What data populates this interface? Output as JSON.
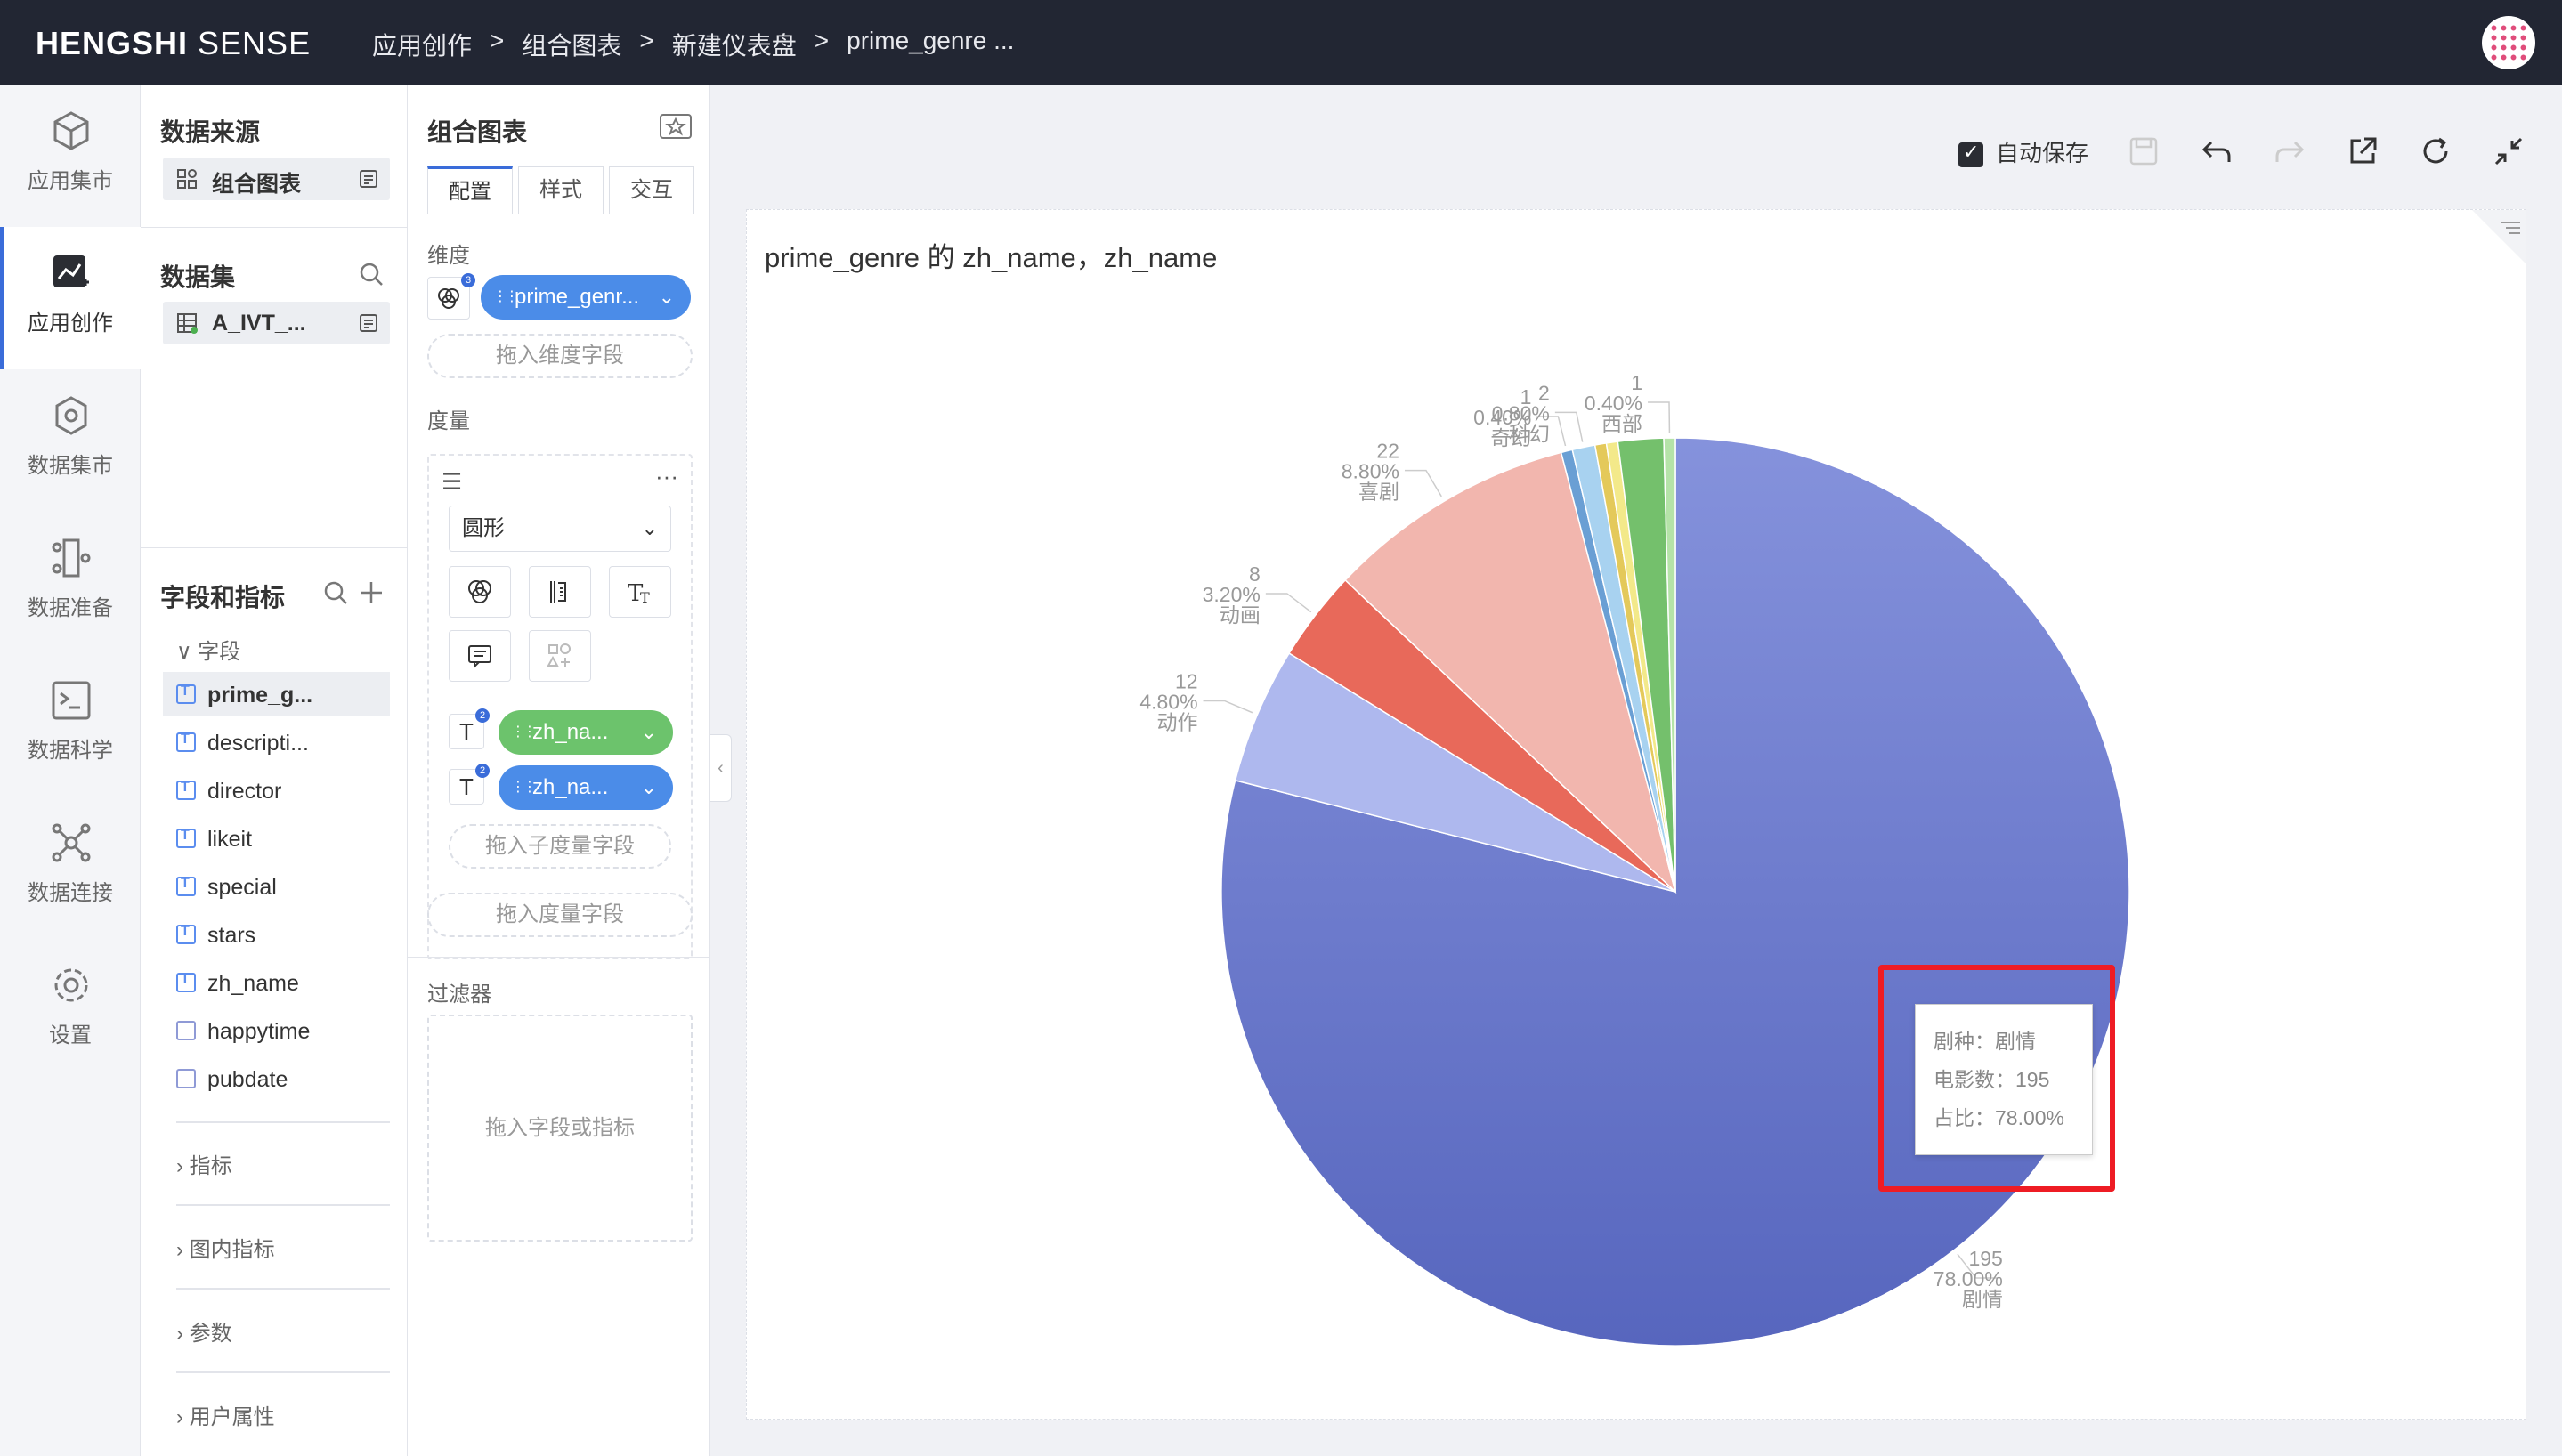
{
  "header": {
    "brand_bold": "HENGSHI",
    "brand_light": " SENSE",
    "breadcrumbs": [
      "应用创作",
      "组合图表",
      "新建仪表盘",
      "prime_genre ..."
    ],
    "separator": ">"
  },
  "nav": {
    "items": [
      {
        "label": "应用集市"
      },
      {
        "label": "应用创作"
      },
      {
        "label": "数据集市"
      },
      {
        "label": "数据准备"
      },
      {
        "label": "数据科学"
      },
      {
        "label": "数据连接"
      },
      {
        "label": "设置"
      }
    ]
  },
  "panel1": {
    "source_title": "数据来源",
    "source_value": "组合图表",
    "dataset_title": "数据集",
    "dataset_value": "A_IVT_...",
    "fields_title": "字段和指标",
    "fields_group": "字段",
    "fields": [
      "prime_g...",
      "descripti...",
      "director",
      "likeit",
      "special",
      "stars",
      "zh_name",
      "happytime",
      "pubdate"
    ],
    "groups": [
      "指标",
      "图内指标",
      "参数",
      "用户属性"
    ]
  },
  "panel2": {
    "title": "组合图表",
    "tabs": [
      "配置",
      "样式",
      "交互"
    ],
    "dimension_label": "维度",
    "dimension_badge": "3",
    "dimension_pill": "prime_genr...",
    "dimension_drop": "拖入维度字段",
    "measure_label": "度量",
    "chart_type": "圆形",
    "measure_badge_1": "2",
    "measure_pill_1": "zh_na...",
    "measure_badge_2": "2",
    "measure_pill_2": "zh_na...",
    "sub_measure_drop": "拖入子度量字段",
    "measure_drop": "拖入度量字段",
    "filter_label": "过滤器",
    "filter_drop": "拖入字段或指标"
  },
  "toolbar": {
    "autosave_label": "自动保存"
  },
  "chart": {
    "title": "prime_genre 的 zh_name，zh_name"
  },
  "chart_data": {
    "type": "pie",
    "title": "prime_genre 的 zh_name，zh_name",
    "slices": [
      {
        "name": "剧情",
        "value": 195,
        "percent": "78.00%",
        "color": "#6a7bd0"
      },
      {
        "name": "动作",
        "value": 12,
        "percent": "4.80%",
        "color": "#aeb8ee"
      },
      {
        "name": "动画",
        "value": 8,
        "percent": "3.20%",
        "color": "#e8695a"
      },
      {
        "name": "喜剧",
        "value": 22,
        "percent": "8.80%",
        "color": "#f2b6ae"
      },
      {
        "name": "奇幻",
        "value": 1,
        "percent": "0.40%",
        "color": "#6a9fd4"
      },
      {
        "name": "科幻",
        "value": 2,
        "percent": "0.80%",
        "color": "#a8d2f0"
      },
      {
        "name": "",
        "value": 1,
        "percent": "",
        "color": "#e4c95a"
      },
      {
        "name": "",
        "value": 1,
        "percent": "",
        "color": "#f3e98a"
      },
      {
        "name": "",
        "value": 4,
        "percent": "",
        "color": "#74c06c"
      },
      {
        "name": "西部",
        "value": 1,
        "percent": "0.40%",
        "color": "#b5e3a8"
      }
    ]
  },
  "tooltip": {
    "line1": "剧种：剧情",
    "line2": "电影数：195",
    "line3": "占比：78.00%"
  }
}
